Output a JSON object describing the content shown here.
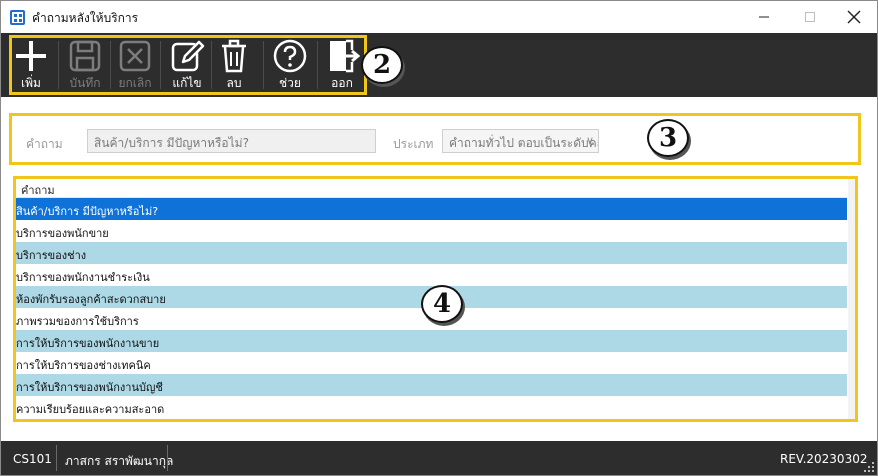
{
  "window": {
    "title": "คำถามหลังให้บริการ",
    "minimize_icon": "minimize-icon",
    "maximize_icon": "maximize-icon",
    "close_icon": "close-icon"
  },
  "toolbar": {
    "add_label": "เพิ่ม",
    "save_label": "บันทึก",
    "cancel_label": "ยกเลิก",
    "edit_label": "แก้ไข",
    "delete_label": "ลบ",
    "help_label": "ช่วย",
    "exit_label": "ออก"
  },
  "callouts": {
    "toolbar": "2",
    "filter": "3",
    "grid": "4"
  },
  "filter": {
    "question_label": "คำถาม",
    "question_value": "สินค้า/บริการ มีปัญหาหรือไม่?",
    "type_label": "ประเภท",
    "type_value": "คำถามทั่วไป ตอบเป็นระดับคะแนน"
  },
  "grid": {
    "column_header": "คำถาม",
    "rows": [
      "สินค้า/บริการ มีปัญหาหรือไม่?",
      "บริการของพนักขาย",
      "บริการของช่าง",
      "บริการของพนักงานชำระเงิน",
      "ห้องพักรับรองลูกค้าสะดวกสบาย",
      "ภาพรวมของการใช้บริการ",
      "การให้บริการของพนักงานขาย",
      "การให้บริการของช่างเทคนิค",
      "การให้บริการของพนักงานบัญชี",
      "ความเรียบร้อยและความสะอาด"
    ]
  },
  "statusbar": {
    "code": "CS101",
    "user": "ภาสกร สราพัฒนากุล",
    "revision": "REV.20230302"
  },
  "colors": {
    "toolbar_bg": "#2d2d2d",
    "selected_row": "#0f72d8",
    "alt_row": "#add8e6",
    "callout_border": "#f0c61a"
  }
}
